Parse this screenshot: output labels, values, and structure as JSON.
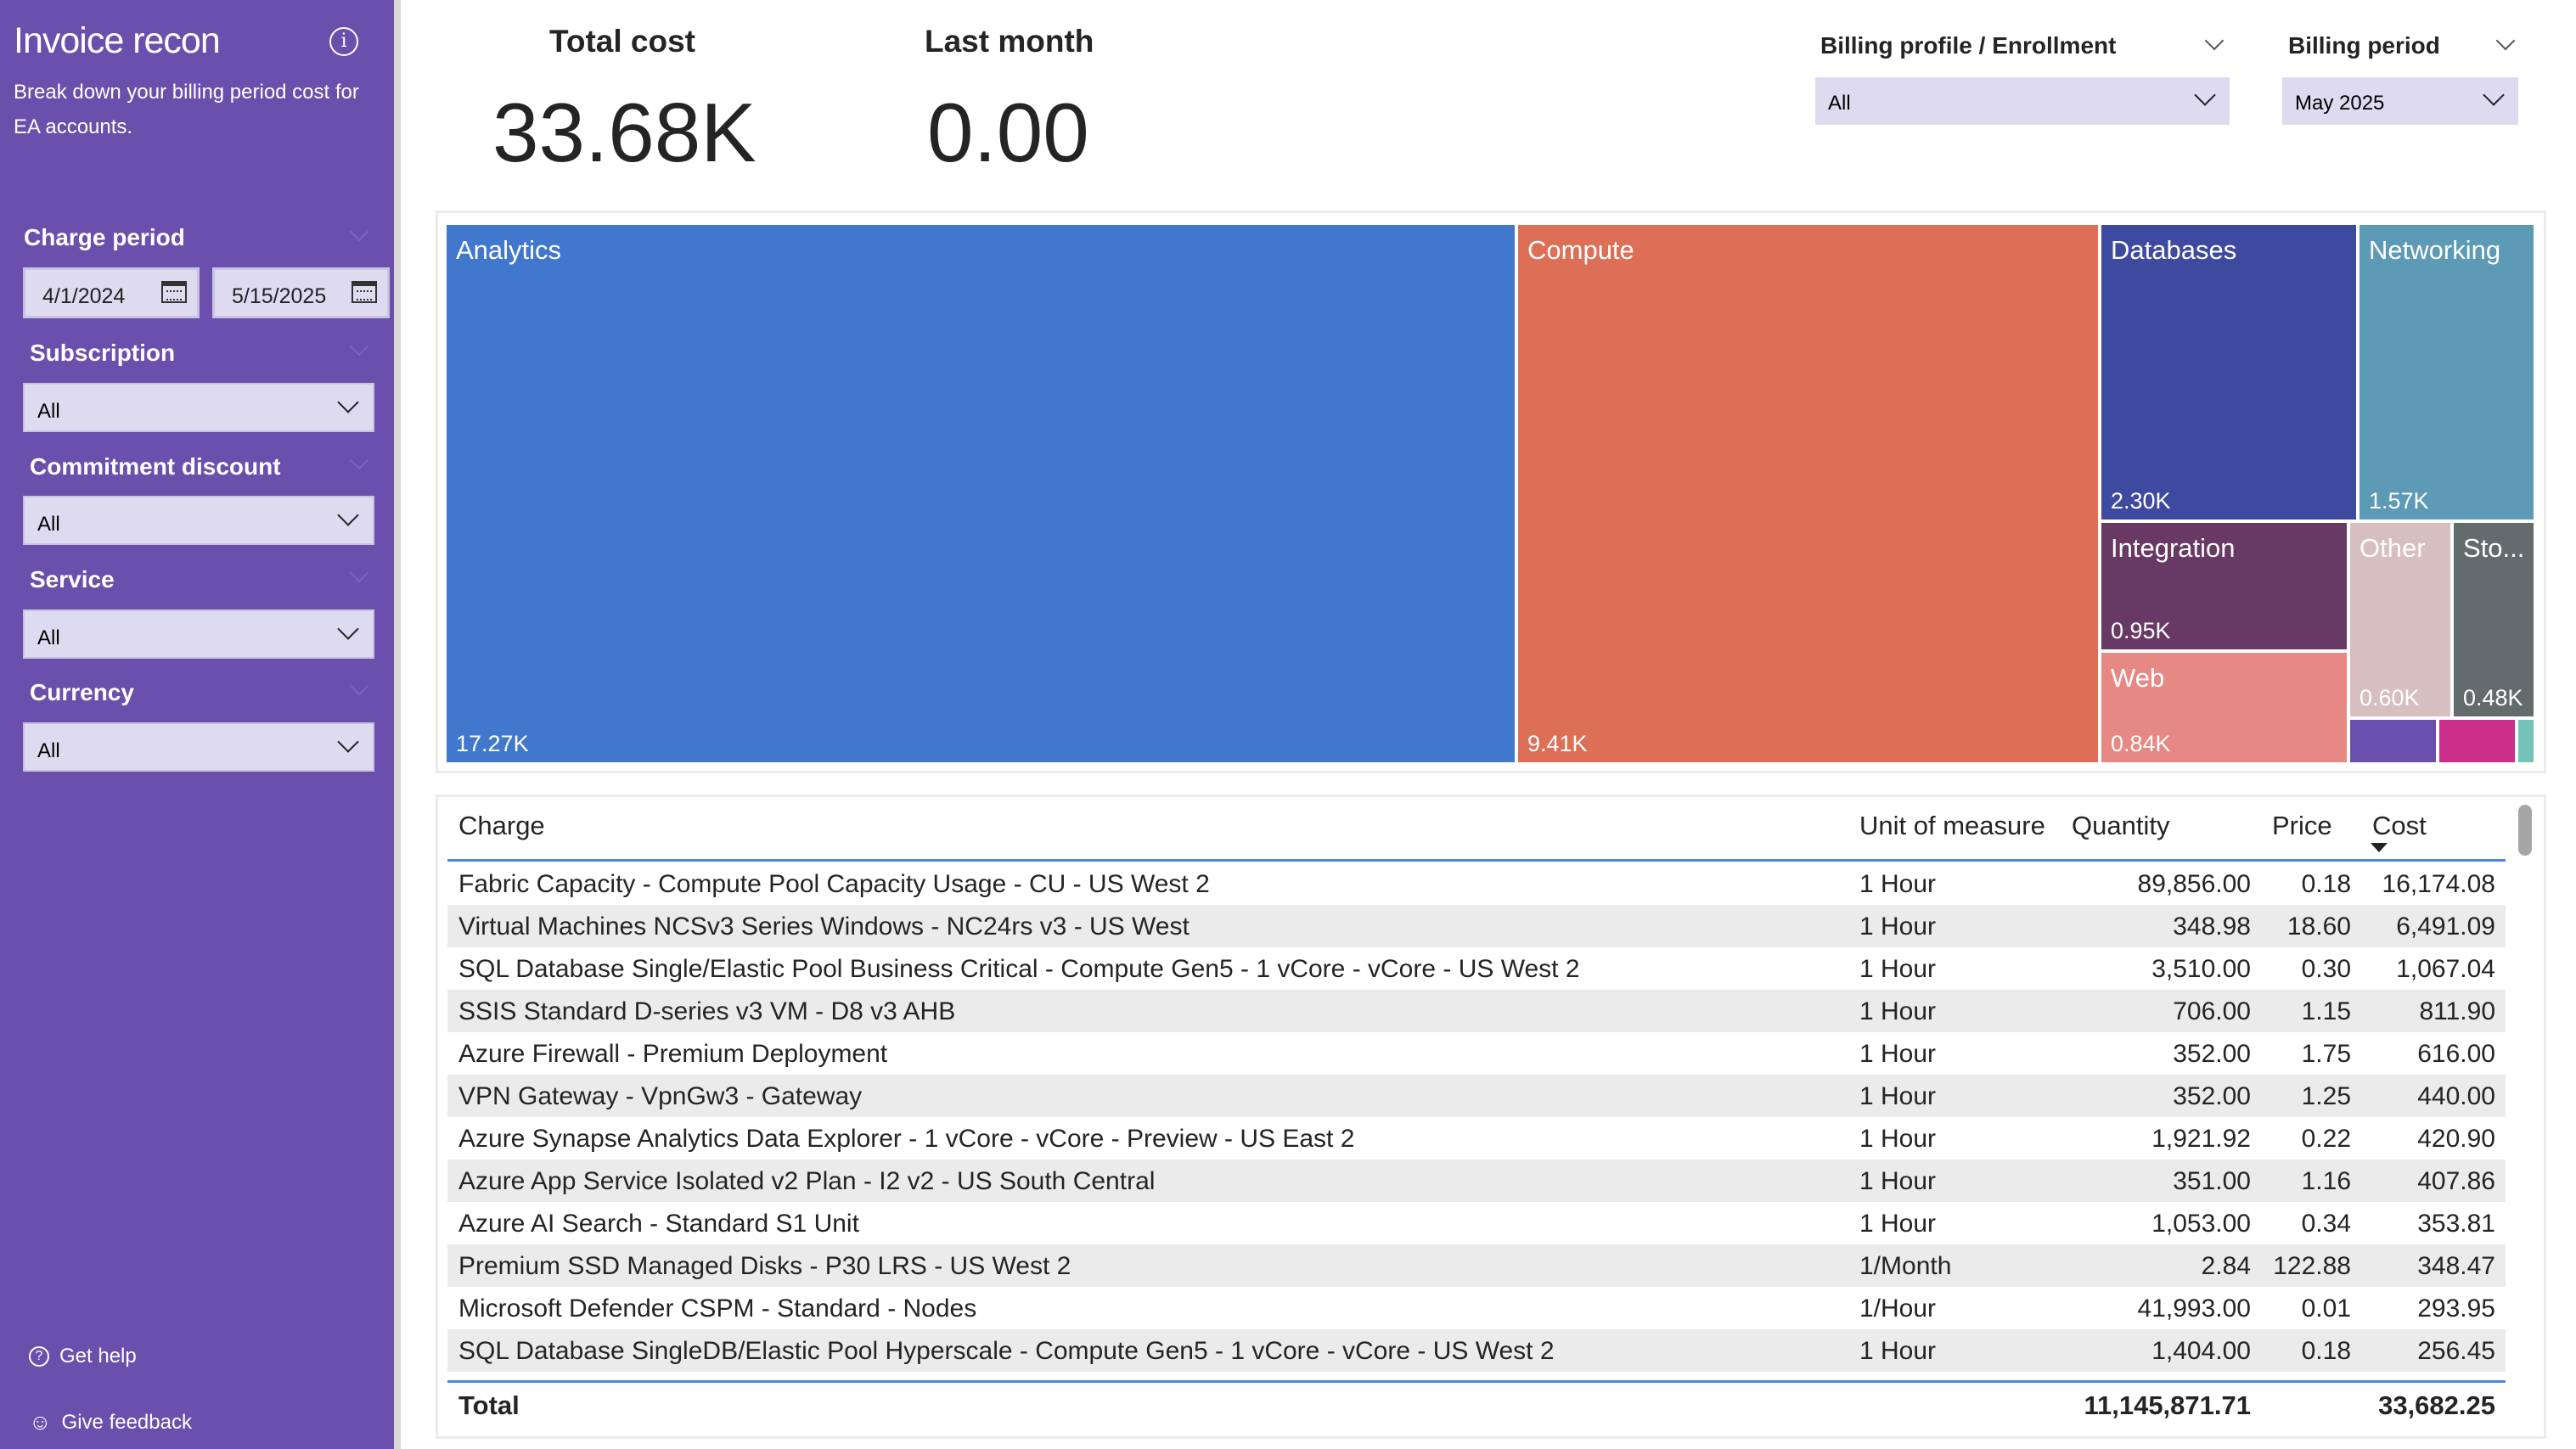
{
  "sidebar": {
    "title": "Invoice recon",
    "subtitle": "Break down your billing period cost for EA accounts.",
    "filters": {
      "charge_period": {
        "label": "Charge period",
        "start": "4/1/2024",
        "end": "5/15/2025"
      },
      "subscription": {
        "label": "Subscription",
        "value": "All"
      },
      "commitment_discount": {
        "label": "Commitment discount",
        "value": "All"
      },
      "service": {
        "label": "Service",
        "value": "All"
      },
      "currency": {
        "label": "Currency",
        "value": "All"
      }
    },
    "get_help": "Get help",
    "give_feedback": "Give feedback",
    "background_color": "#6b4fad"
  },
  "kpis": {
    "total_cost": {
      "label": "Total cost",
      "value": "33.68K"
    },
    "last_month": {
      "label": "Last month",
      "value": "0.00"
    }
  },
  "slicers": {
    "billing_profile": {
      "label": "Billing profile / Enrollment",
      "value": "All"
    },
    "billing_period": {
      "label": "Billing period",
      "value": "May 2025"
    }
  },
  "chart_data": {
    "type": "treemap",
    "items": [
      {
        "name": "Analytics",
        "value": 17.27,
        "label": "17.27K",
        "color": "#4178ce"
      },
      {
        "name": "Compute",
        "value": 9.41,
        "label": "9.41K",
        "color": "#dd6f57"
      },
      {
        "name": "Databases",
        "value": 2.3,
        "label": "2.30K",
        "color": "#3e4aa0"
      },
      {
        "name": "Networking",
        "value": 1.57,
        "label": "1.57K",
        "color": "#5d9ab6"
      },
      {
        "name": "Integration",
        "value": 0.95,
        "label": "0.95K",
        "color": "#683965"
      },
      {
        "name": "Web",
        "value": 0.84,
        "label": "0.84K",
        "color": "#e68883"
      },
      {
        "name": "Other",
        "value": 0.6,
        "label": "0.60K",
        "color": "#d8bfbf"
      },
      {
        "name": "Sto...",
        "value": 0.48,
        "label": "0.48K",
        "color": "#636b6c"
      },
      {
        "name": "",
        "label": "",
        "color": "#6b4fac"
      },
      {
        "name": "",
        "label": "",
        "color": "#cb2e8a"
      },
      {
        "name": "",
        "label": "",
        "color": "#74c3b9"
      }
    ]
  },
  "table": {
    "columns": [
      "Charge",
      "Unit of measure",
      "Quantity",
      "Price",
      "Cost"
    ],
    "sort": "Cost descending",
    "rows": [
      [
        "Fabric Capacity - Compute Pool Capacity Usage - CU - US West 2",
        "1 Hour",
        "89,856.00",
        "0.18",
        "16,174.08"
      ],
      [
        "Virtual Machines NCSv3 Series Windows - NC24rs v3 - US West",
        "1 Hour",
        "348.98",
        "18.60",
        "6,491.09"
      ],
      [
        "SQL Database Single/Elastic Pool Business Critical - Compute Gen5 - 1 vCore - vCore - US West 2",
        "1 Hour",
        "3,510.00",
        "0.30",
        "1,067.04"
      ],
      [
        "SSIS Standard D-series v3 VM - D8 v3 AHB",
        "1 Hour",
        "706.00",
        "1.15",
        "811.90"
      ],
      [
        "Azure Firewall - Premium Deployment",
        "1 Hour",
        "352.00",
        "1.75",
        "616.00"
      ],
      [
        "VPN Gateway - VpnGw3 - Gateway",
        "1 Hour",
        "352.00",
        "1.25",
        "440.00"
      ],
      [
        "Azure Synapse Analytics Data Explorer - 1 vCore - vCore - Preview - US East 2",
        "1 Hour",
        "1,921.92",
        "0.22",
        "420.90"
      ],
      [
        "Azure App Service Isolated v2 Plan - I2 v2 - US South Central",
        "1 Hour",
        "351.00",
        "1.16",
        "407.86"
      ],
      [
        "Azure AI Search - Standard S1 Unit",
        "1 Hour",
        "1,053.00",
        "0.34",
        "353.81"
      ],
      [
        "Premium SSD Managed Disks - P30 LRS - US West 2",
        "1/Month",
        "2.84",
        "122.88",
        "348.47"
      ],
      [
        "Microsoft Defender CSPM - Standard - Nodes",
        "1/Hour",
        "41,993.00",
        "0.01",
        "293.95"
      ],
      [
        "SQL Database SingleDB/Elastic Pool Hyperscale - Compute Gen5 - 1 vCore - vCore - US West 2",
        "1 Hour",
        "1,404.00",
        "0.18",
        "256.45"
      ]
    ],
    "total": {
      "label": "Total",
      "quantity": "11,145,871.71",
      "cost": "33,682.25"
    }
  }
}
